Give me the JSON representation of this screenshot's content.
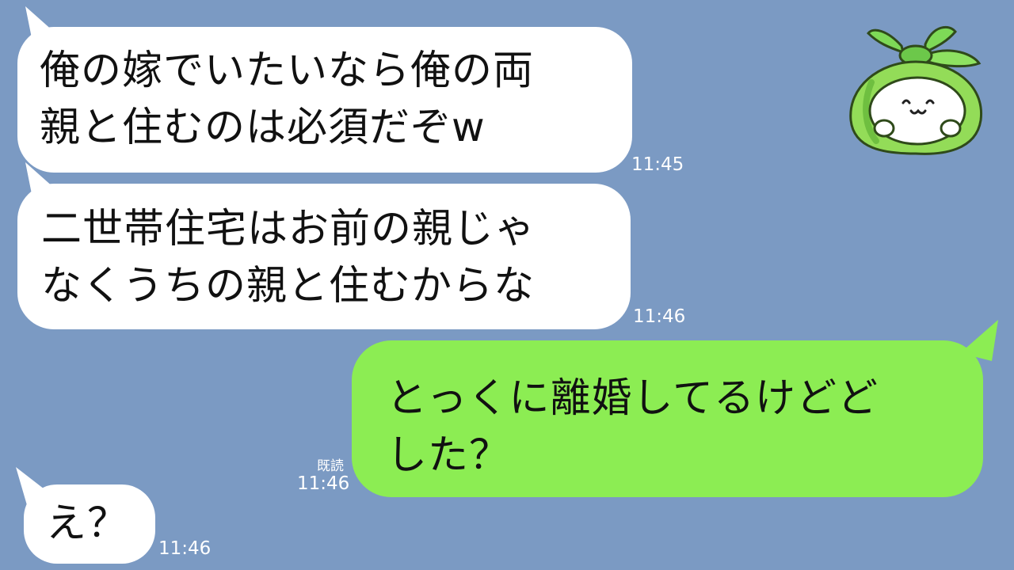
{
  "chat": {
    "messages": [
      {
        "sender": "them",
        "lines": [
          "俺の嫁でいたいなら俺の両",
          "親と住むのは必須だぞw"
        ],
        "time": "11:45"
      },
      {
        "sender": "them",
        "lines": [
          "二世帯住宅はお前の親じゃ",
          "なくうちの親と住むからな"
        ],
        "time": "11:46"
      },
      {
        "sender": "me",
        "lines": [
          "とっくに離婚してるけどど",
          "した？"
        ],
        "read_label": "既読",
        "time": "11:46"
      },
      {
        "sender": "them",
        "lines": [
          "え？"
        ],
        "time": "11:46"
      }
    ]
  },
  "avatar": {
    "icon": "green-bundle-mascot-icon",
    "face": "(˘ω˘)"
  },
  "colors": {
    "background": "#7b9ac3",
    "incoming_bubble": "#ffffff",
    "outgoing_bubble": "#8ced53",
    "text": "#111111",
    "meta_text": "#ffffff"
  }
}
